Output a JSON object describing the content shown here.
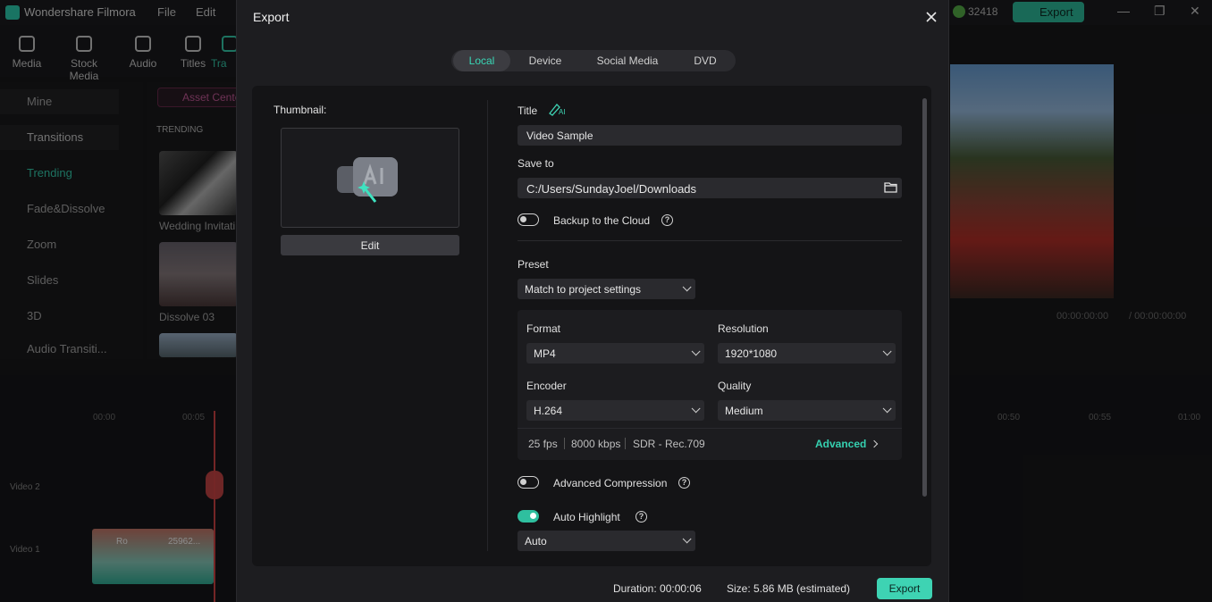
{
  "app": {
    "name": "Wondershare Filmora",
    "menu": [
      "File",
      "Edit"
    ],
    "credits": "32418",
    "export_label": "Export",
    "tools": [
      "Media",
      "Stock Media",
      "Audio",
      "Titles",
      "Tra"
    ],
    "sidebar": {
      "mine": "Mine",
      "transitions": "Transitions",
      "items": [
        "Trending",
        "Fade&Dissolve",
        "Zoom",
        "Slides",
        "3D",
        "Audio Transiti..."
      ]
    },
    "asset_center": "Asset Cente",
    "trending": "TRENDING",
    "thumbs": [
      "Wedding Invitati",
      "Dissolve 03"
    ],
    "preview_time": "00:00:00:00",
    "preview_total": "/ 00:00:00:00",
    "ruler": [
      "00:00",
      "00:05",
      "00:50",
      "00:55",
      "01:00"
    ],
    "tracks": [
      "Video 2",
      "Video 1"
    ],
    "clips": [
      "Ro",
      "25962..."
    ]
  },
  "dialog": {
    "title": "Export",
    "tabs": [
      "Local",
      "Device",
      "Social Media",
      "DVD"
    ],
    "active_tab": "Local",
    "thumbnail_label": "Thumbnail:",
    "edit_label": "Edit",
    "title_label": "Title",
    "ai_label": "AI",
    "title_value": "Video Sample",
    "save_to_label": "Save to",
    "save_to_value": "C:/Users/SundayJoel/Downloads",
    "backup_label": "Backup to the Cloud",
    "backup_on": false,
    "preset_label": "Preset",
    "preset_value": "Match to project settings",
    "format_label": "Format",
    "format_value": "MP4",
    "resolution_label": "Resolution",
    "resolution_value": "1920*1080",
    "encoder_label": "Encoder",
    "encoder_value": "H.264",
    "quality_label": "Quality",
    "quality_value": "Medium",
    "fps": "25 fps",
    "bitrate": "8000 kbps",
    "color": "SDR - Rec.709",
    "advanced_label": "Advanced",
    "adv_compression_label": "Advanced Compression",
    "adv_compression_on": false,
    "auto_highlight_label": "Auto Highlight",
    "auto_highlight_on": true,
    "auto_value": "Auto",
    "duration": "Duration: 00:00:06",
    "size": "Size: 5.86 MB (estimated)",
    "export_label": "Export"
  },
  "colors": {
    "accent": "#2fbf9f",
    "dialog_bg": "#1d1d20",
    "card_bg": "#141416"
  }
}
